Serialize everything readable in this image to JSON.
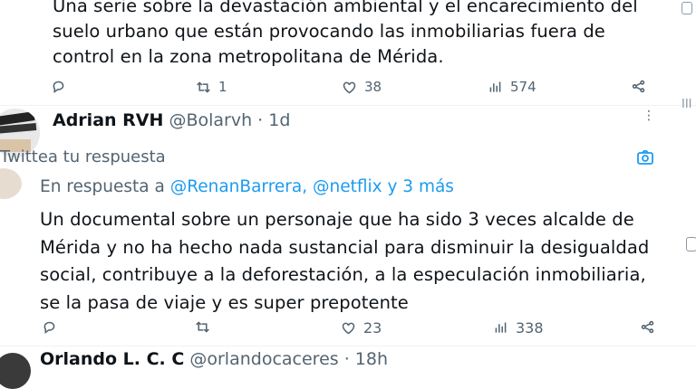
{
  "top_tweet": {
    "lines": [
      "Una serie sobre la devastación ambiental y el encarecimiento del",
      "suelo urbano que están provocando las inmobiliarias fuera de",
      "control en la zona metropolitana de Mérida."
    ],
    "actions": {
      "reply": "",
      "retweet": "1",
      "like": "38",
      "views": "574"
    }
  },
  "reply_tweet": {
    "author_name": "Adrian RVH",
    "author_handle": "@Bolarvh",
    "time": "· 1d",
    "more_icon": "more-dots-icon",
    "compose_placeholder": "Twittea tu respuesta",
    "reply_prefix": "En respuesta a",
    "reply_to": "@RenanBarrera, @netflix y 3 más",
    "lines": [
      "Un documental sobre un personaje que ha sido 3 veces alcalde de",
      "Mérida y no ha hecho nada sustancial para disminuir la desigualdad",
      "social, contribuye a la deforestación, a la especulación inmobiliaria,",
      "se la pasa de viaje y es super prepotente"
    ],
    "actions": {
      "reply": "",
      "retweet": "",
      "like": "23",
      "views": "338"
    }
  },
  "next_tweet": {
    "author_name": "Orlando L. C. C",
    "author_handle": "@orlandocaceres",
    "time": "· 18h"
  },
  "colors": {
    "accent": "#1d9bf0",
    "muted": "#536471",
    "text": "#0f1419"
  }
}
